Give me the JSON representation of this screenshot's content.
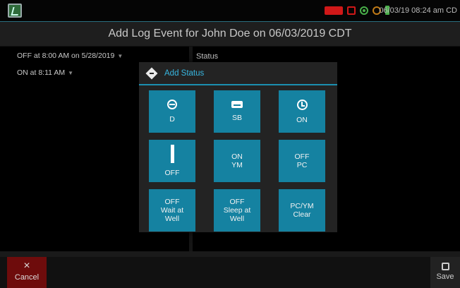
{
  "statusbar": {
    "datetime": "06/03/19 08:24 am CD",
    "icons": [
      "app-icon",
      "truck-icon",
      "calendar-icon",
      "gps-icon",
      "signal-icon",
      "power-plug-icon"
    ],
    "colors": {
      "alert": "#d01818",
      "ok": "#49b04a",
      "warn": "#c07a16"
    }
  },
  "title": "Add Log Event for John Doe on 06/03/2019 CDT",
  "left_list": {
    "items": [
      {
        "label": "OFF at 8:00 AM on 5/28/2019"
      },
      {
        "label": "ON at 8:11 AM"
      }
    ]
  },
  "right_pane": {
    "label": "Status"
  },
  "modal": {
    "title": "Add Status",
    "accent": "#1b8fb0",
    "tile_color": "#1582a1",
    "tiles": [
      {
        "label": "D",
        "icon": "steering-wheel-icon"
      },
      {
        "label": "SB",
        "icon": "sofa-icon"
      },
      {
        "label": "ON",
        "icon": "clock-icon"
      },
      {
        "label": "OFF",
        "icon": "pause-icon"
      },
      {
        "label": "ON\nYM",
        "icon": ""
      },
      {
        "label": "OFF\nPC",
        "icon": ""
      },
      {
        "label": "OFF\nWait at\nWell",
        "icon": ""
      },
      {
        "label": "OFF\nSleep at\nWell",
        "icon": ""
      },
      {
        "label": "PC/YM\nClear",
        "icon": ""
      }
    ]
  },
  "bottombar": {
    "cancel_label": "Cancel",
    "cancel_glyph": "×",
    "save_label": "Save",
    "cancel_color": "#6e0c0c"
  }
}
